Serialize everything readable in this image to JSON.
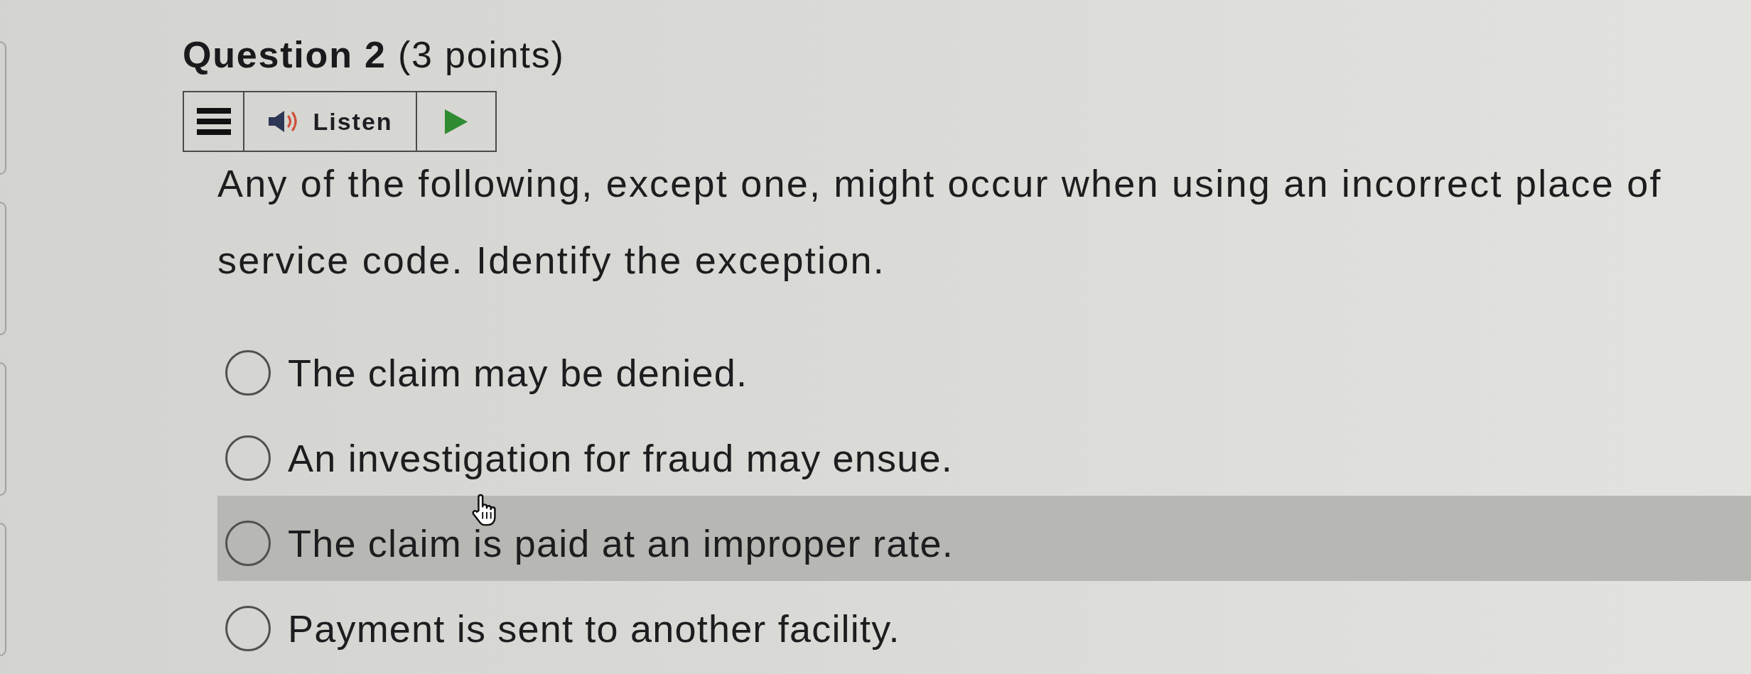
{
  "question": {
    "title": "**Question 2** (3 points)"
  },
  "audio_toolbar": {
    "label": "Listen"
  },
  "prompt": "Any of the following, except one, might occur when using an incorrect place of service code. Identify the exception.",
  "options": [
    {
      "label": "The claim may be denied.",
      "selected": false,
      "hovered": false
    },
    {
      "label": "An investigation for fraud may ensue.",
      "selected": false,
      "hovered": false
    },
    {
      "label": "The claim is paid at an improper rate.",
      "selected": false,
      "hovered": true
    },
    {
      "label": "Payment is sent to another facility.",
      "selected": false,
      "hovered": false
    }
  ]
}
